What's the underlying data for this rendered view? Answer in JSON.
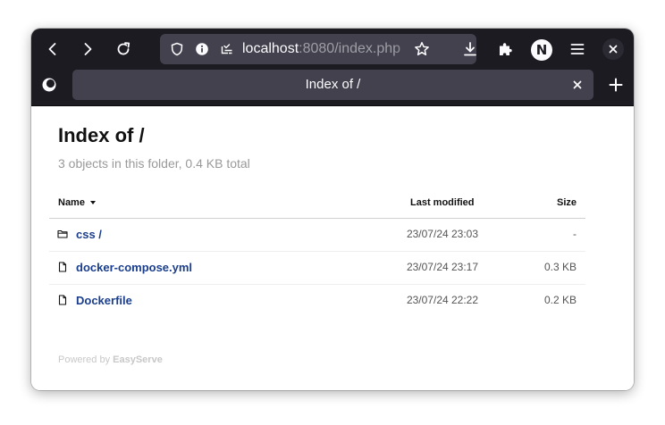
{
  "browser": {
    "url_host": "localhost",
    "url_rest": ":8080/index.php",
    "avatar_letter": "N",
    "tab_title": "Index of /"
  },
  "page": {
    "title": "Index of /",
    "summary": "3 objects in this folder, 0.4 KB total",
    "columns": {
      "name": "Name",
      "modified": "Last modified",
      "size": "Size"
    },
    "rows": [
      {
        "name": "css /",
        "modified": "23/07/24 23:03",
        "size": "-",
        "icon": "folder-icon"
      },
      {
        "name": "docker-compose.yml",
        "modified": "23/07/24 23:17",
        "size": "0.3 KB",
        "icon": "file-icon"
      },
      {
        "name": "Dockerfile",
        "modified": "23/07/24 22:22",
        "size": "0.2 KB",
        "icon": "file-icon"
      }
    ],
    "footer_prefix": "Powered by",
    "footer_brand": "EasyServe"
  },
  "colors": {
    "toolbar_bg": "#1c1b22",
    "urlbar_bg": "#42414d",
    "link": "#1a3e8c",
    "muted_text": "#999999"
  }
}
